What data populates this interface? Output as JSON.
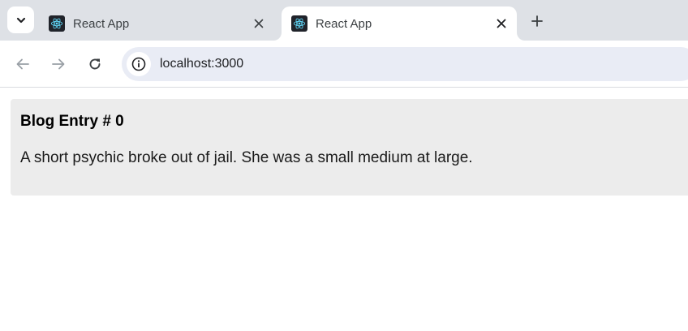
{
  "browser": {
    "tabs": [
      {
        "title": "React App",
        "active": false
      },
      {
        "title": "React App",
        "active": true
      }
    ],
    "address_bar": {
      "url": "localhost:3000"
    },
    "icons": {
      "tab_search": "chevron-down-icon",
      "favicon": "react-logo-icon",
      "close": "close-icon",
      "new_tab": "plus-icon",
      "back": "back-arrow-icon",
      "forward": "forward-arrow-icon",
      "reload": "reload-icon",
      "site_info": "info-icon"
    },
    "colors": {
      "tabstrip": "#dee1e6",
      "omnibox": "#e9ecf5",
      "react_blue": "#61dafb"
    }
  },
  "page": {
    "blog": {
      "title": "Blog Entry # 0",
      "text": "A short psychic broke out of jail. She was a small medium at large."
    },
    "card_color": "#ececec"
  }
}
